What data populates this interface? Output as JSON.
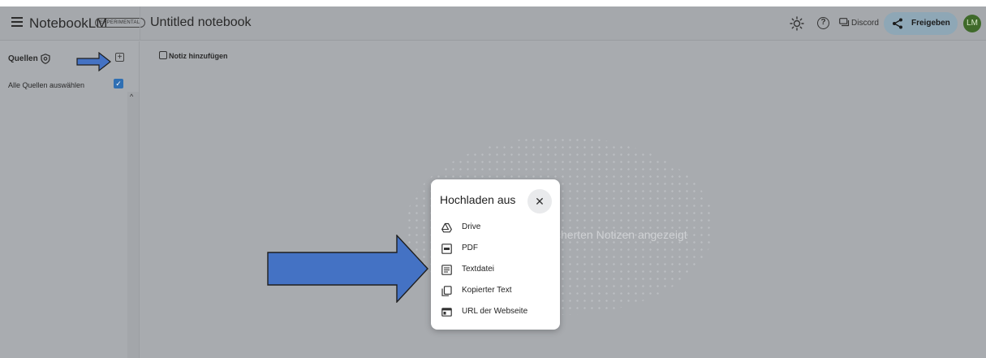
{
  "header": {
    "app_title": "NotebookLM",
    "badge": "EXPERIMENTAL",
    "notebook_title": "Untitled notebook",
    "discord_label": "Discord",
    "share_label": "Freigeben",
    "avatar_initials": "LM"
  },
  "sidebar": {
    "sources_label": "Quellen",
    "select_all_label": "Alle Quellen auswählen",
    "select_all_checked": true
  },
  "main": {
    "add_note_label": "Notiz hinzufügen",
    "background_text": "cherten Notizen angezeigt"
  },
  "upload_dialog": {
    "title": "Hochladen aus",
    "options": [
      {
        "label": "Drive",
        "icon": "drive-icon"
      },
      {
        "label": "PDF",
        "icon": "pdf-icon"
      },
      {
        "label": "Textdatei",
        "icon": "text-file-icon"
      },
      {
        "label": "Kopierter Text",
        "icon": "copy-icon"
      },
      {
        "label": "URL der Webseite",
        "icon": "web-icon"
      }
    ]
  },
  "colors": {
    "accent_arrow": "#4472c4",
    "share_button": "#8ea7b6",
    "avatar": "#3f6a2a",
    "checkbox": "#2f6fb3"
  }
}
